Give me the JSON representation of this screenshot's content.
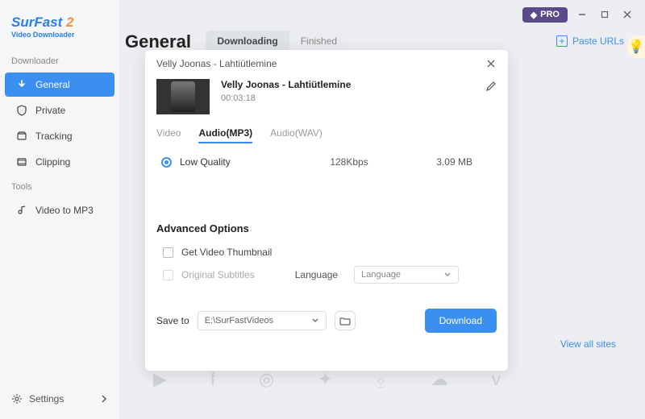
{
  "titlebar": {
    "pro": "PRO"
  },
  "logo": {
    "name": "SurFast",
    "suffix": "2",
    "tagline": "Video Downloader"
  },
  "sidebar": {
    "section1": "Downloader",
    "items": [
      {
        "label": "General",
        "icon": "arrow-down-icon"
      },
      {
        "label": "Private",
        "icon": "shield-icon"
      },
      {
        "label": "Tracking",
        "icon": "archive-icon"
      },
      {
        "label": "Clipping",
        "icon": "film-icon"
      }
    ],
    "section2": "Tools",
    "tools": [
      {
        "label": "Video to MP3",
        "icon": "note-icon"
      }
    ],
    "settings": "Settings"
  },
  "page": {
    "title": "General",
    "tabs": [
      "Downloading",
      "Finished"
    ],
    "paste": "Paste URLs",
    "viewall": "View all sites"
  },
  "modal": {
    "header": "Velly Joonas - Lahtiütlemine",
    "media": {
      "title": "Velly Joonas - Lahtiütlemine",
      "duration": "00:03:18"
    },
    "formats": [
      "Video",
      "Audio(MP3)",
      "Audio(WAV)"
    ],
    "quality": {
      "name": "Low Quality",
      "bitrate": "128Kbps",
      "size": "3.09 MB"
    },
    "advanced": {
      "title": "Advanced Options",
      "opt1": "Get Video Thumbnail",
      "opt2": "Original Subtitles",
      "langLabel": "Language",
      "langPlaceholder": "Language"
    },
    "save": {
      "label": "Save to",
      "path": "E:\\SurFastVideos"
    },
    "download": "Download"
  }
}
